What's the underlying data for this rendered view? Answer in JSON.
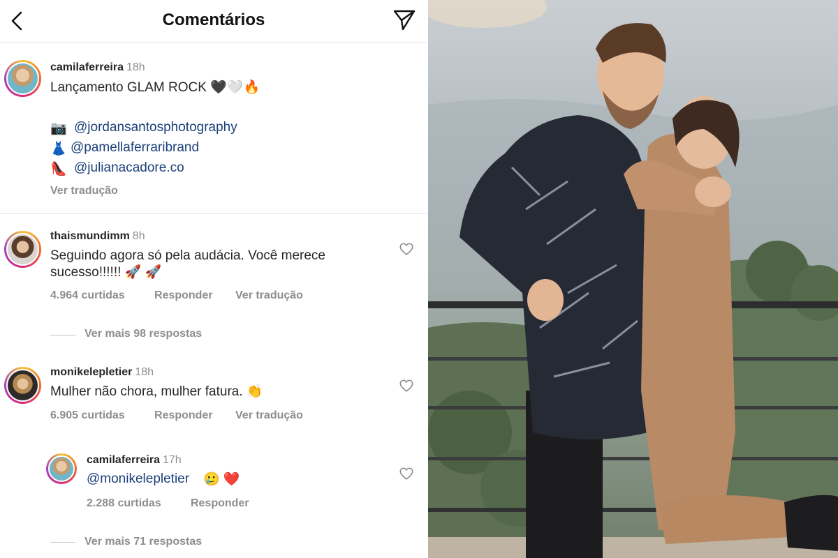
{
  "header": {
    "title": "Comentários"
  },
  "post": {
    "username": "camilaferreira",
    "time": "18h",
    "caption": "Lançamento GLAM ROCK 🖤🤍🔥",
    "credits": [
      {
        "emoji": "📷",
        "handle": "@jordansantosphotography"
      },
      {
        "emoji": "👗",
        "handle": "@pamellaferraribrand"
      },
      {
        "emoji": "👠",
        "handle": "@julianacadore.co"
      }
    ],
    "translate": "Ver tradução"
  },
  "comments": [
    {
      "username": "thaismundimm",
      "time": "8h",
      "text_line1": "Seguindo agora só pela audácia. Você merece",
      "text_line2": "sucesso!!!!!! 🚀 🚀",
      "likes": "4.964 curtidas",
      "reply": "Responder",
      "translate": "Ver tradução",
      "more_replies": "Ver mais 98 respostas"
    },
    {
      "username": "monikelepletier",
      "time": "18h",
      "text_line1": "Mulher não chora, mulher fatura. 👏",
      "likes": "6.905 curtidas",
      "reply": "Responder",
      "translate": "Ver tradução",
      "more_replies": "Ver mais 71 respostas",
      "replies": [
        {
          "username": "camilaferreira",
          "time": "17h",
          "mention": "@monikelepletier",
          "text_rest": "🥲 ❤️",
          "likes": "2.288 curtidas",
          "reply": "Responder"
        }
      ]
    }
  ],
  "icons": [
    "back-arrow-icon",
    "send-icon",
    "heart-icon"
  ],
  "colors": {
    "link": "#1c3f7a",
    "muted": "#8e8e8e",
    "text": "#262626"
  }
}
